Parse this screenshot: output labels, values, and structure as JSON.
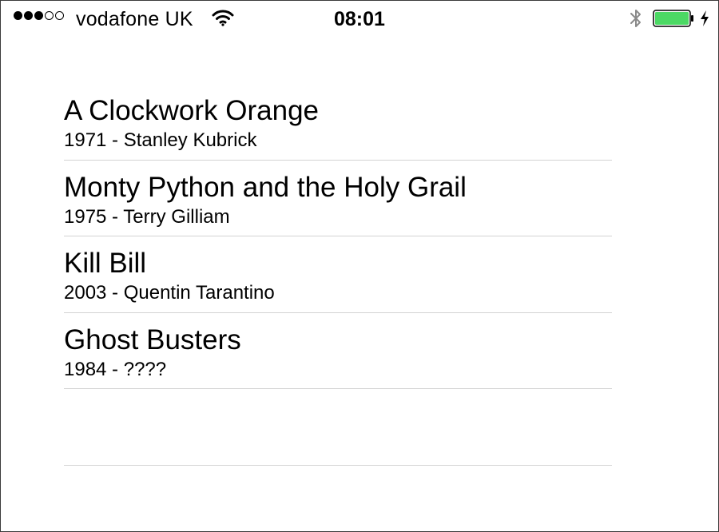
{
  "status_bar": {
    "signal_bars_filled": 3,
    "signal_bars_total": 5,
    "carrier": "vodafone UK",
    "time": "08:01",
    "battery_color": "#4cd964",
    "icons": [
      "signal-dots",
      "wifi-icon",
      "bluetooth-icon",
      "battery-icon",
      "charging-bolt-icon"
    ]
  },
  "movies": [
    {
      "title": "A Clockwork Orange",
      "subtitle": "1971 - Stanley Kubrick"
    },
    {
      "title": "Monty Python and the Holy Grail",
      "subtitle": "1975 - Terry Gilliam"
    },
    {
      "title": "Kill Bill",
      "subtitle": "2003 - Quentin Tarantino"
    },
    {
      "title": "Ghost Busters",
      "subtitle": "1984 - ????"
    }
  ]
}
